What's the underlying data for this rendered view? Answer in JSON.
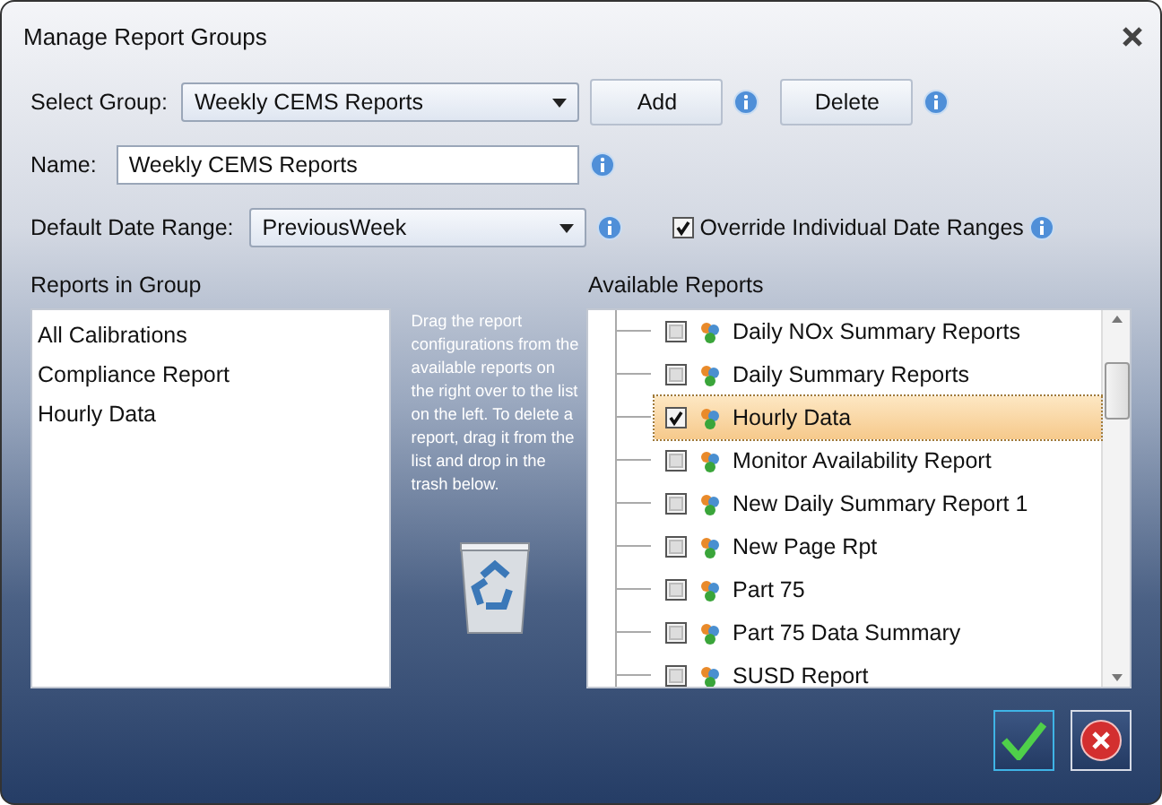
{
  "window": {
    "title": "Manage Report Groups"
  },
  "select_group": {
    "label": "Select Group:",
    "value": "Weekly CEMS Reports"
  },
  "group_buttons": [
    "Add",
    "Delete"
  ],
  "name": {
    "label": "Name:",
    "value": "Weekly CEMS Reports"
  },
  "date_range": {
    "label": "Default Date Range:",
    "value": "PreviousWeek"
  },
  "override": {
    "label": "Override Individual Date Ranges",
    "checked": true
  },
  "reports_in_group": {
    "title": "Reports in Group",
    "items": [
      "All Calibrations",
      "Compliance Report",
      "Hourly Data"
    ]
  },
  "instructions": "Drag the report configurations from the available reports on the right over to the list on the left. To delete a report, drag it from the list and drop in the trash below.",
  "available_reports": {
    "title": "Available Reports",
    "items": [
      {
        "label": "Daily NOx Summary Reports",
        "checked": false,
        "selected": false
      },
      {
        "label": "Daily Summary Reports",
        "checked": false,
        "selected": false
      },
      {
        "label": "Hourly Data",
        "checked": true,
        "selected": true
      },
      {
        "label": "Monitor Availability Report",
        "checked": false,
        "selected": false
      },
      {
        "label": "New Daily Summary Report 1",
        "checked": false,
        "selected": false
      },
      {
        "label": "New Page Rpt",
        "checked": false,
        "selected": false
      },
      {
        "label": "Part 75",
        "checked": false,
        "selected": false
      },
      {
        "label": "Part 75 Data Summary",
        "checked": false,
        "selected": false
      },
      {
        "label": "SUSD Report",
        "checked": false,
        "selected": false
      }
    ]
  }
}
